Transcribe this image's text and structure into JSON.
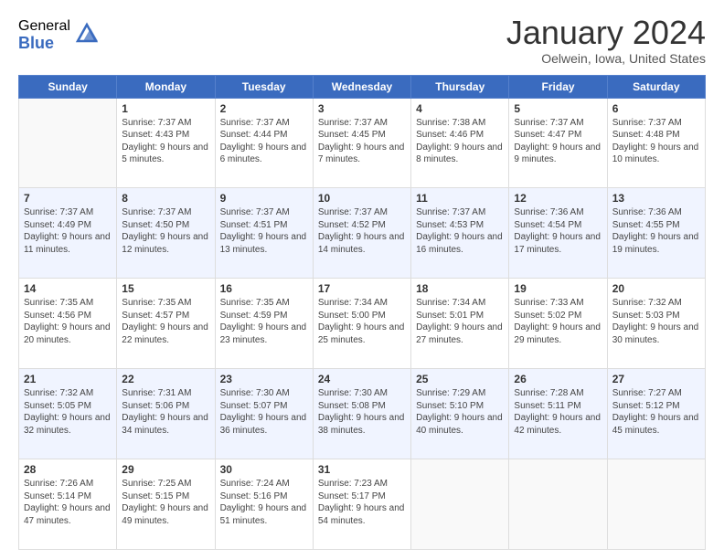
{
  "logo": {
    "general": "General",
    "blue": "Blue"
  },
  "title": "January 2024",
  "subtitle": "Oelwein, Iowa, United States",
  "headers": [
    "Sunday",
    "Monday",
    "Tuesday",
    "Wednesday",
    "Thursday",
    "Friday",
    "Saturday"
  ],
  "weeks": [
    [
      {
        "day": "",
        "sunrise": "",
        "sunset": "",
        "daylight": "",
        "empty": true
      },
      {
        "day": "1",
        "sunrise": "Sunrise: 7:37 AM",
        "sunset": "Sunset: 4:43 PM",
        "daylight": "Daylight: 9 hours and 5 minutes."
      },
      {
        "day": "2",
        "sunrise": "Sunrise: 7:37 AM",
        "sunset": "Sunset: 4:44 PM",
        "daylight": "Daylight: 9 hours and 6 minutes."
      },
      {
        "day": "3",
        "sunrise": "Sunrise: 7:37 AM",
        "sunset": "Sunset: 4:45 PM",
        "daylight": "Daylight: 9 hours and 7 minutes."
      },
      {
        "day": "4",
        "sunrise": "Sunrise: 7:38 AM",
        "sunset": "Sunset: 4:46 PM",
        "daylight": "Daylight: 9 hours and 8 minutes."
      },
      {
        "day": "5",
        "sunrise": "Sunrise: 7:37 AM",
        "sunset": "Sunset: 4:47 PM",
        "daylight": "Daylight: 9 hours and 9 minutes."
      },
      {
        "day": "6",
        "sunrise": "Sunrise: 7:37 AM",
        "sunset": "Sunset: 4:48 PM",
        "daylight": "Daylight: 9 hours and 10 minutes."
      }
    ],
    [
      {
        "day": "7",
        "sunrise": "Sunrise: 7:37 AM",
        "sunset": "Sunset: 4:49 PM",
        "daylight": "Daylight: 9 hours and 11 minutes."
      },
      {
        "day": "8",
        "sunrise": "Sunrise: 7:37 AM",
        "sunset": "Sunset: 4:50 PM",
        "daylight": "Daylight: 9 hours and 12 minutes."
      },
      {
        "day": "9",
        "sunrise": "Sunrise: 7:37 AM",
        "sunset": "Sunset: 4:51 PM",
        "daylight": "Daylight: 9 hours and 13 minutes."
      },
      {
        "day": "10",
        "sunrise": "Sunrise: 7:37 AM",
        "sunset": "Sunset: 4:52 PM",
        "daylight": "Daylight: 9 hours and 14 minutes."
      },
      {
        "day": "11",
        "sunrise": "Sunrise: 7:37 AM",
        "sunset": "Sunset: 4:53 PM",
        "daylight": "Daylight: 9 hours and 16 minutes."
      },
      {
        "day": "12",
        "sunrise": "Sunrise: 7:36 AM",
        "sunset": "Sunset: 4:54 PM",
        "daylight": "Daylight: 9 hours and 17 minutes."
      },
      {
        "day": "13",
        "sunrise": "Sunrise: 7:36 AM",
        "sunset": "Sunset: 4:55 PM",
        "daylight": "Daylight: 9 hours and 19 minutes."
      }
    ],
    [
      {
        "day": "14",
        "sunrise": "Sunrise: 7:35 AM",
        "sunset": "Sunset: 4:56 PM",
        "daylight": "Daylight: 9 hours and 20 minutes."
      },
      {
        "day": "15",
        "sunrise": "Sunrise: 7:35 AM",
        "sunset": "Sunset: 4:57 PM",
        "daylight": "Daylight: 9 hours and 22 minutes."
      },
      {
        "day": "16",
        "sunrise": "Sunrise: 7:35 AM",
        "sunset": "Sunset: 4:59 PM",
        "daylight": "Daylight: 9 hours and 23 minutes."
      },
      {
        "day": "17",
        "sunrise": "Sunrise: 7:34 AM",
        "sunset": "Sunset: 5:00 PM",
        "daylight": "Daylight: 9 hours and 25 minutes."
      },
      {
        "day": "18",
        "sunrise": "Sunrise: 7:34 AM",
        "sunset": "Sunset: 5:01 PM",
        "daylight": "Daylight: 9 hours and 27 minutes."
      },
      {
        "day": "19",
        "sunrise": "Sunrise: 7:33 AM",
        "sunset": "Sunset: 5:02 PM",
        "daylight": "Daylight: 9 hours and 29 minutes."
      },
      {
        "day": "20",
        "sunrise": "Sunrise: 7:32 AM",
        "sunset": "Sunset: 5:03 PM",
        "daylight": "Daylight: 9 hours and 30 minutes."
      }
    ],
    [
      {
        "day": "21",
        "sunrise": "Sunrise: 7:32 AM",
        "sunset": "Sunset: 5:05 PM",
        "daylight": "Daylight: 9 hours and 32 minutes."
      },
      {
        "day": "22",
        "sunrise": "Sunrise: 7:31 AM",
        "sunset": "Sunset: 5:06 PM",
        "daylight": "Daylight: 9 hours and 34 minutes."
      },
      {
        "day": "23",
        "sunrise": "Sunrise: 7:30 AM",
        "sunset": "Sunset: 5:07 PM",
        "daylight": "Daylight: 9 hours and 36 minutes."
      },
      {
        "day": "24",
        "sunrise": "Sunrise: 7:30 AM",
        "sunset": "Sunset: 5:08 PM",
        "daylight": "Daylight: 9 hours and 38 minutes."
      },
      {
        "day": "25",
        "sunrise": "Sunrise: 7:29 AM",
        "sunset": "Sunset: 5:10 PM",
        "daylight": "Daylight: 9 hours and 40 minutes."
      },
      {
        "day": "26",
        "sunrise": "Sunrise: 7:28 AM",
        "sunset": "Sunset: 5:11 PM",
        "daylight": "Daylight: 9 hours and 42 minutes."
      },
      {
        "day": "27",
        "sunrise": "Sunrise: 7:27 AM",
        "sunset": "Sunset: 5:12 PM",
        "daylight": "Daylight: 9 hours and 45 minutes."
      }
    ],
    [
      {
        "day": "28",
        "sunrise": "Sunrise: 7:26 AM",
        "sunset": "Sunset: 5:14 PM",
        "daylight": "Daylight: 9 hours and 47 minutes."
      },
      {
        "day": "29",
        "sunrise": "Sunrise: 7:25 AM",
        "sunset": "Sunset: 5:15 PM",
        "daylight": "Daylight: 9 hours and 49 minutes."
      },
      {
        "day": "30",
        "sunrise": "Sunrise: 7:24 AM",
        "sunset": "Sunset: 5:16 PM",
        "daylight": "Daylight: 9 hours and 51 minutes."
      },
      {
        "day": "31",
        "sunrise": "Sunrise: 7:23 AM",
        "sunset": "Sunset: 5:17 PM",
        "daylight": "Daylight: 9 hours and 54 minutes."
      },
      {
        "day": "",
        "sunrise": "",
        "sunset": "",
        "daylight": "",
        "empty": true
      },
      {
        "day": "",
        "sunrise": "",
        "sunset": "",
        "daylight": "",
        "empty": true
      },
      {
        "day": "",
        "sunrise": "",
        "sunset": "",
        "daylight": "",
        "empty": true
      }
    ]
  ]
}
